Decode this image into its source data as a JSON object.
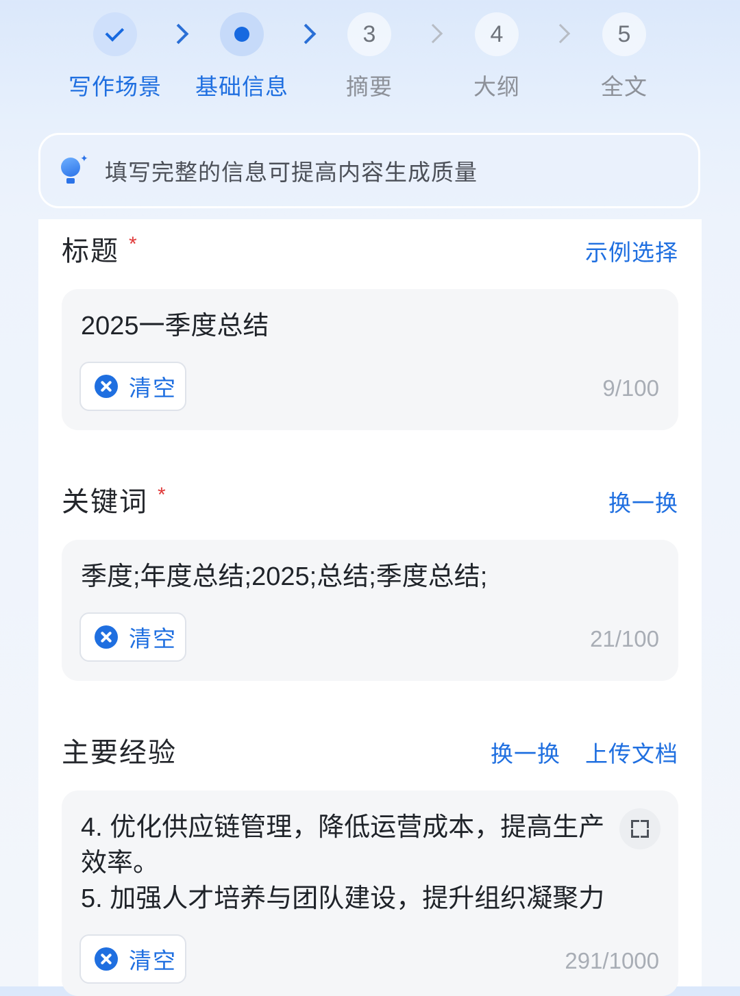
{
  "steps": [
    {
      "state": "done",
      "label": "写作场景"
    },
    {
      "state": "current",
      "label": "基础信息"
    },
    {
      "state": "pending",
      "number": "3",
      "label": "摘要"
    },
    {
      "state": "pending",
      "number": "4",
      "label": "大纲"
    },
    {
      "state": "pending",
      "number": "5",
      "label": "全文"
    }
  ],
  "tip": {
    "icon": "lightbulb-icon",
    "text": "填写完整的信息可提高内容生成质量"
  },
  "fields": {
    "title": {
      "label": "标题",
      "required_mark": "*",
      "action": "示例选择",
      "value": "2025一季度总结",
      "clear_label": "清空",
      "counter": "9/100"
    },
    "keywords": {
      "label": "关键词",
      "required_mark": "*",
      "action": "换一换",
      "value": "季度;年度总结;2025;总结;季度总结;",
      "clear_label": "清空",
      "counter": "21/100"
    },
    "experience": {
      "label": "主要经验",
      "action_refresh": "换一换",
      "action_upload": "上传文档",
      "value": "4. 优化供应链管理，降低运营成本，提高生产效率。\n5. 加强人才培养与团队建设，提升组织凝聚力",
      "clear_label": "清空",
      "counter": "291/1000"
    }
  },
  "colors": {
    "accent": "#1f6fe0",
    "required": "#e03a3a",
    "muted_text": "#a8adb5"
  }
}
